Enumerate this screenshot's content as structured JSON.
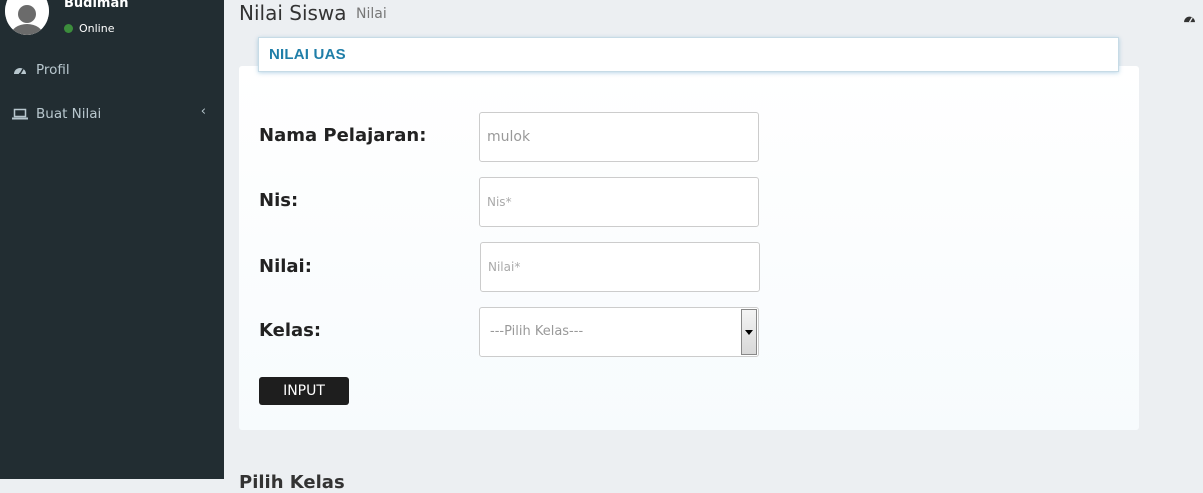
{
  "sidebar": {
    "user": {
      "name": "Budiman",
      "status": "Online",
      "status_color": "#3c8d3c"
    },
    "items": [
      {
        "label": "Profil",
        "icon": "dashboard-icon"
      },
      {
        "label": "Buat Nilai",
        "icon": "laptop-icon",
        "has_submenu": true
      }
    ]
  },
  "header": {
    "title": "Nilai Siswa",
    "subtitle": "Nilai"
  },
  "card": {
    "title": "NILAI UAS",
    "title_color": "#1f7ea8"
  },
  "form": {
    "subject_label": "Nama Pelajaran:",
    "subject_value": "mulok",
    "nis_label": "Nis:",
    "nis_placeholder": "Nis*",
    "nilai_label": "Nilai:",
    "nilai_placeholder": "Nilai*",
    "kelas_label": "Kelas:",
    "kelas_selected": "---Pilih Kelas---",
    "submit_label": "INPUT"
  },
  "below": {
    "partial_heading": "Pilih Kelas"
  }
}
